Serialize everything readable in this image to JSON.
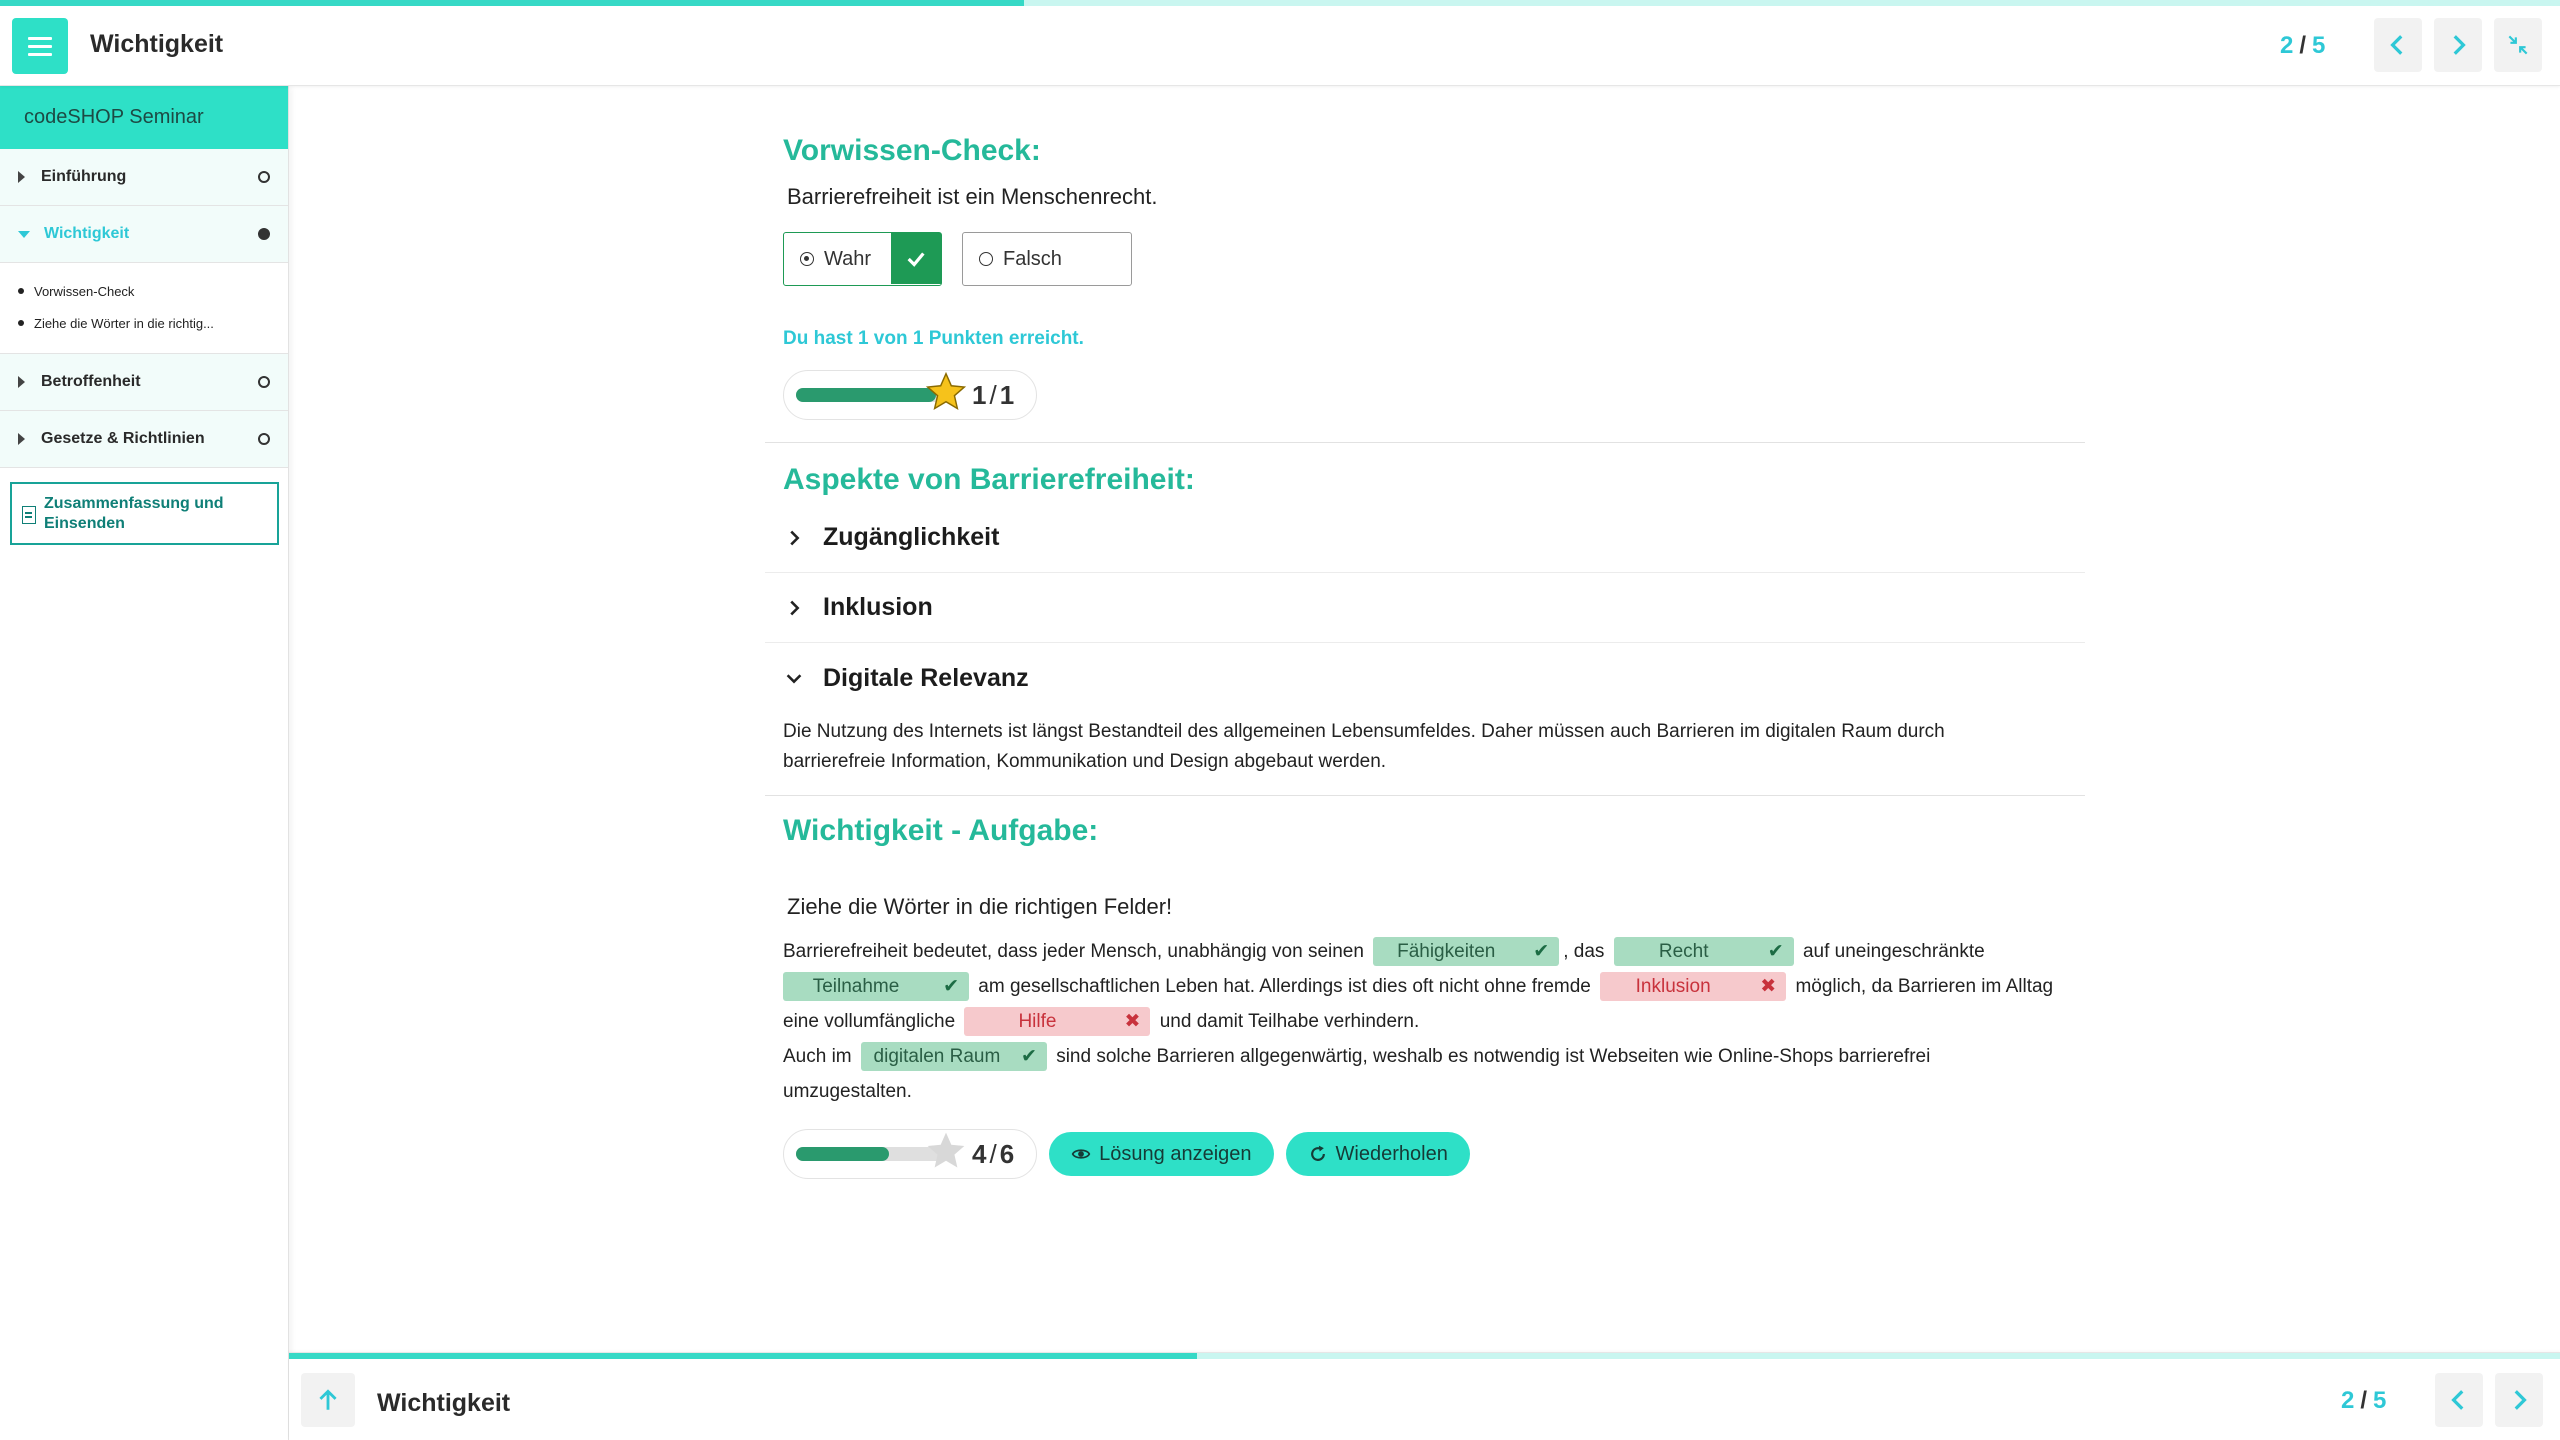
{
  "header": {
    "title": "Wichtigkeit",
    "page_current": "2",
    "page_total": "5",
    "progress": 0.4
  },
  "sidebar": {
    "course_title": "codeSHOP Seminar",
    "items": [
      {
        "label": "Einführung",
        "status": "open"
      },
      {
        "label": "Wichtigkeit",
        "status": "current"
      },
      {
        "label": "Betroffenheit",
        "status": "open"
      },
      {
        "label": "Gesetze & Richtlinien",
        "status": "open"
      }
    ],
    "subitems": [
      "Vorwissen-Check",
      "Ziehe die Wörter in die richtig..."
    ],
    "summary_button": "Zusammenfassung und Einsenden"
  },
  "quiz": {
    "title": "Vorwissen-Check:",
    "question": "Barrierefreiheit ist ein Menschenrecht.",
    "option_true": "Wahr",
    "option_false": "Falsch",
    "feedback": "Du hast 1 von 1 Punkten erreicht.",
    "score_current": "1",
    "score_max": "1",
    "score_fraction": 1.0
  },
  "accordion": {
    "title": "Aspekte von Barrierefreiheit:",
    "items": [
      "Zugänglichkeit",
      "Inklusion",
      "Digitale Relevanz"
    ],
    "expanded_text": "Die Nutzung des Internets ist längst Bestandteil des allgemeinen Lebensumfeldes. Daher müssen auch Barrieren im digitalen Raum durch barrierefreie Information, Kommunikation und Design abgebaut werden."
  },
  "task": {
    "title": "Wichtigkeit - Aufgabe:",
    "instruction": "Ziehe die Wörter in die richtigen Felder!",
    "t1": "Barrierefreiheit bedeutet, dass jeder Mensch, unabhängig von seinen",
    "t2": ", das",
    "t3": "auf uneingeschränkte",
    "t4": "am gesellschaftlichen Leben hat. Allerdings ist dies oft nicht ohne fremde",
    "t5": "möglich, da Barrieren im Alltag eine vollumfängliche",
    "t6": "und damit Teilhabe verhindern.",
    "t7": "Auch im",
    "t8": "sind solche Barrieren allgegenwärtig, weshalb es notwendig ist Webseiten wie Online-Shops barrierefrei umzugestalten.",
    "chips": {
      "c1": {
        "text": "Fähigkeiten",
        "correct": true
      },
      "c2": {
        "text": "Recht",
        "correct": true
      },
      "c3": {
        "text": "Teilnahme",
        "correct": true
      },
      "c4": {
        "text": "Inklusion",
        "correct": false
      },
      "c5": {
        "text": "Hilfe",
        "correct": false
      },
      "c6": {
        "text": "digitalen Raum",
        "correct": true
      }
    },
    "score_current": "4",
    "score_max": "6",
    "score_fraction": 0.667,
    "show_solution": "Lösung anzeigen",
    "retry": "Wiederholen"
  },
  "footer": {
    "title": "Wichtigkeit",
    "page_current": "2",
    "page_total": "5",
    "progress": 0.4
  },
  "colors": {
    "accent": "#2ee0c7",
    "heading": "#25b99a",
    "correct": "#1e9a55",
    "wrong": "#c8323c"
  }
}
